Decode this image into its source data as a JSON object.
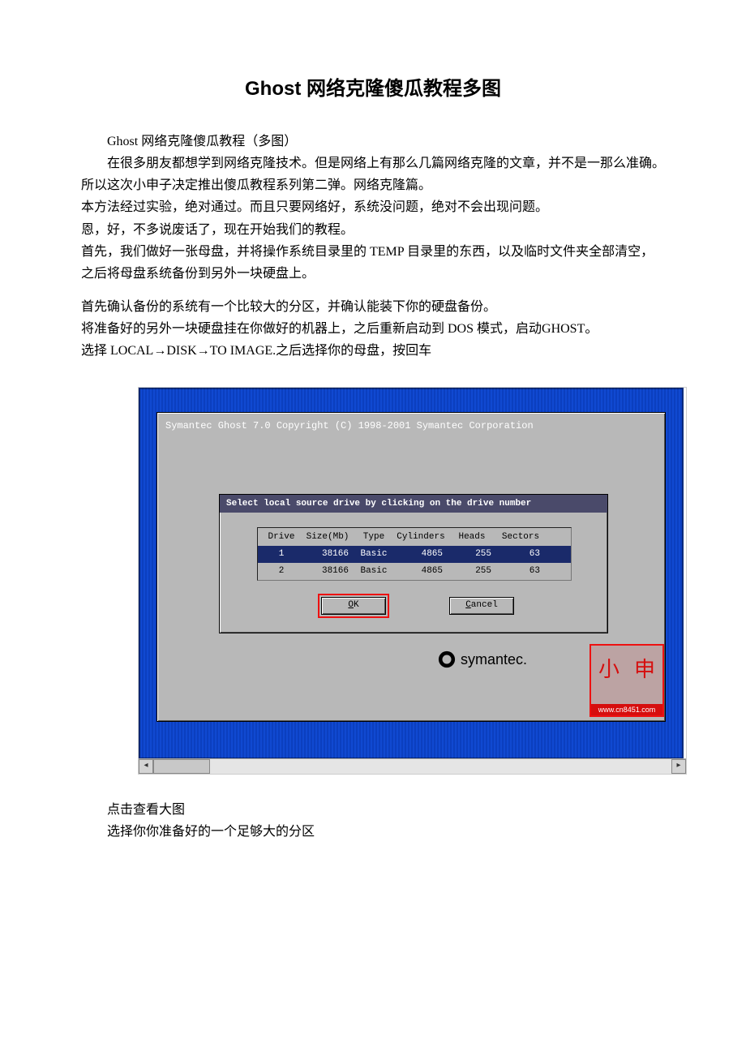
{
  "doc": {
    "title": "Ghost 网络克隆傻瓜教程多图",
    "p1": "Ghost 网络克隆傻瓜教程（多图）",
    "p2": "在很多朋友都想学到网络克隆技术。但是网络上有那么几篇网络克隆的文章，并不是一那么准确。",
    "l1": "所以这次小申子决定推出傻瓜教程系列第二弹。网络克隆篇。",
    "l2": "本方法经过实验，绝对通过。而且只要网络好，系统没问题，绝对不会出现问题。",
    "l3": "恩，好，不多说废话了，现在开始我们的教程。",
    "l4": "首先，我们做好一张母盘，并将操作系统目录里的 TEMP 目录里的东西，以及临时文件夹全部清空，之后将母盘系统备份到另外一块硬盘上。",
    "l5": "首先确认备份的系统有一个比较大的分区，并确认能装下你的硬盘备份。",
    "l6": "将准备好的另外一块硬盘挂在你做好的机器上，之后重新启动到 DOS 模式，启动GHOST。",
    "l7": "选择 LOCAL→DISK→TO IMAGE.之后选择你的母盘，按回车",
    "caption": "点击查看大图",
    "p3": "选择你你准备好的一个足够大的分区"
  },
  "ghost": {
    "titlebar": "Symantec Ghost 7.0   Copyright (C) 1998-2001 Symantec Corporation",
    "dialog_title": "Select local source drive by clicking on the drive number",
    "headers": {
      "drive": "Drive",
      "size": "Size(Mb)",
      "type": "Type",
      "cyl": "Cylinders",
      "heads": "Heads",
      "sect": "Sectors"
    },
    "rows": [
      {
        "drive": "1",
        "size": "38166",
        "type": "Basic",
        "cyl": "4865",
        "heads": "255",
        "sect": "63",
        "selected": true
      },
      {
        "drive": "2",
        "size": "38166",
        "type": "Basic",
        "cyl": "4865",
        "heads": "255",
        "sect": "63",
        "selected": false
      }
    ],
    "ok_underline": "O",
    "ok_rest": "K",
    "cancel_underline": "C",
    "cancel_rest": "ancel",
    "symantec": "symantec.",
    "stamp_url": "www.cn8451.com",
    "stamp_g1": "小",
    "stamp_g2": "申"
  }
}
